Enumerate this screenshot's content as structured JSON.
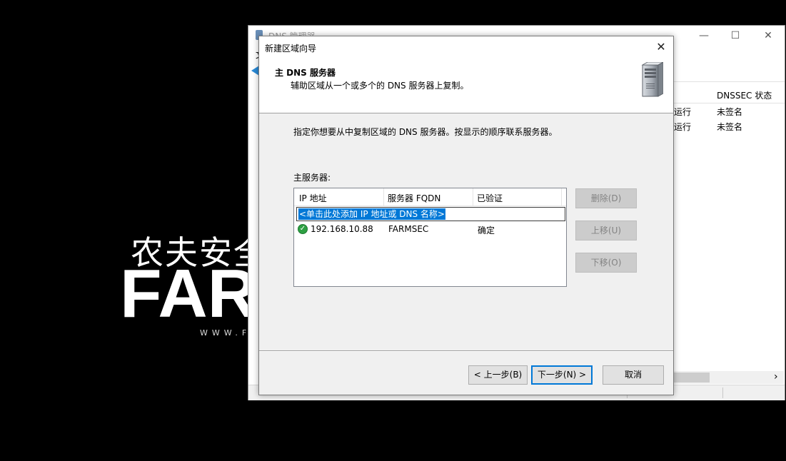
{
  "background": {
    "logo_cn": "农夫安全",
    "logo_en": "FARMSEC",
    "logo_www": "WWW.FARMSEC.COM"
  },
  "main_window": {
    "title": "DNS 管理器",
    "menu_first": "文",
    "controls": {
      "minimize": "—",
      "maximize": "☐",
      "close": "✕"
    },
    "list_header": "DNSSEC 状态",
    "rows": [
      {
        "status": "运行",
        "dnssec": "未签名"
      },
      {
        "status": "运行",
        "dnssec": "未签名"
      }
    ],
    "scroll_right": "›"
  },
  "dialog": {
    "title": "新建区域向导",
    "close": "✕",
    "header_title": "主 DNS 服务器",
    "header_subtitle": "辅助区域从一个或多个的 DNS 服务器上复制。",
    "instruction": "指定你想要从中复制区域的 DNS 服务器。按显示的顺序联系服务器。",
    "master_label": "主服务器:",
    "columns": [
      "IP 地址",
      "服务器 FQDN",
      "已验证"
    ],
    "edit_placeholder": "<单击此处添加 IP 地址或 DNS 名称>",
    "servers": [
      {
        "ip": "192.168.10.88",
        "fqdn": "FARMSEC",
        "verified": "确定",
        "icon": "check-icon"
      }
    ],
    "side_buttons": {
      "delete": "删除(D)",
      "up": "上移(U)",
      "down": "下移(O)"
    },
    "footer_buttons": {
      "back": "< 上一步(B)",
      "next": "下一步(N) >",
      "cancel": "取消"
    }
  },
  "colors": {
    "selection": "#0078d7",
    "dialog_bg": "#f0f0f0",
    "disabled_button": "#cccccc",
    "check_green": "#2ea043"
  }
}
